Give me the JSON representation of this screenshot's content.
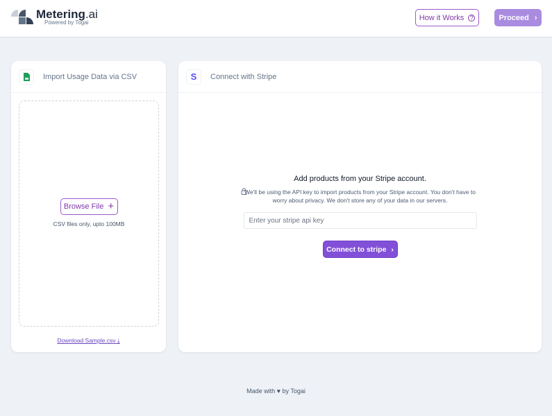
{
  "header": {
    "brand": "Metering",
    "brand_suffix": ".ai",
    "tagline": "Powered by Togai",
    "how_label": "How it Works",
    "proceed_label": "Proceed"
  },
  "csv": {
    "title": "Import Usage Data via CSV",
    "browse_label": "Browse File",
    "hint": "CSV files only, upto 100MB",
    "download_label": "Download Sample.csv"
  },
  "stripe": {
    "title": "Connect with Stripe",
    "heading": "Add products from your Stripe account.",
    "note": "We'll be using the API key to import products from your Stripe account. You don't have to worry about privacy. We don't store any of your data in our servers.",
    "placeholder": "Enter your stripe api key",
    "connect_label": "Connect to stripe"
  },
  "footer": {
    "prefix": "Made with",
    "by": "by",
    "link": "Togai"
  },
  "colors": {
    "accent": "#8250d8",
    "proceed": "#a98be0",
    "background": "#eef2f7"
  }
}
